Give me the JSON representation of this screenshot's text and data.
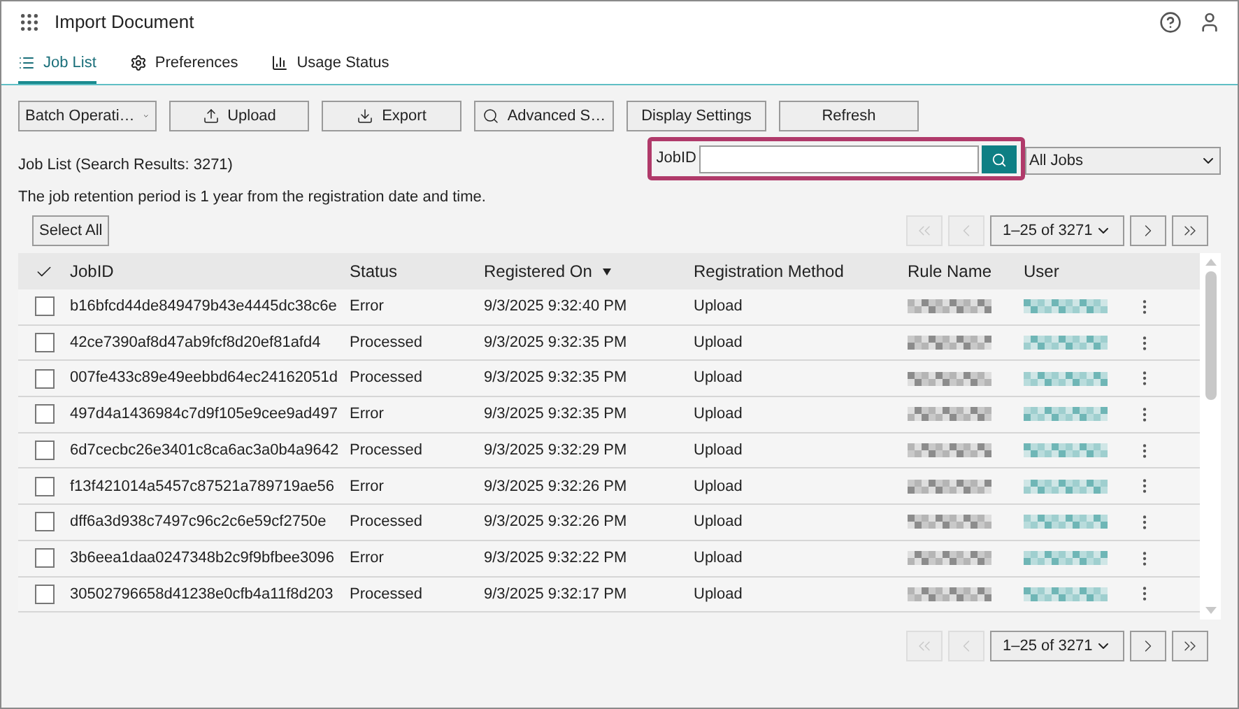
{
  "window": {
    "title": "Import Document"
  },
  "tabs": [
    {
      "label": "Job List",
      "selected": true
    },
    {
      "label": "Preferences",
      "selected": false
    },
    {
      "label": "Usage Status",
      "selected": false
    }
  ],
  "toolbar": [
    {
      "label": "Batch Operati…",
      "kind": "dropdown"
    },
    {
      "label": "Upload",
      "kind": "upload"
    },
    {
      "label": "Export",
      "kind": "export"
    },
    {
      "label": "Advanced S…",
      "kind": "search"
    },
    {
      "label": "Display Settings",
      "kind": "plain"
    },
    {
      "label": "Refresh",
      "kind": "plain"
    }
  ],
  "summary": "Job List (Search Results: 3271)",
  "notice": "The job retention period is 1 year from the registration date and time.",
  "search": {
    "label": "JobID"
  },
  "filter": {
    "value": "All Jobs"
  },
  "select_all": "Select All",
  "pagination_top": {
    "range": "1–25 of 3271",
    "first_disabled": true,
    "prev_disabled": true
  },
  "pagination_bottom": {
    "range": "1–25 of 3271",
    "first_disabled": true,
    "prev_disabled": true
  },
  "table": {
    "columns": [
      "JobID",
      "Status",
      "Registered On",
      "Registration Method",
      "Rule Name",
      "User"
    ],
    "rows": [
      {
        "checked": false,
        "cells": [
          "b16bfcd44de849479b43e4445dc38c6e",
          "Error",
          "9/3/2025 9:32:40 PM",
          "Upload"
        ]
      },
      {
        "checked": false,
        "cells": [
          "42ce7390af8d47ab9fcf8d20ef81afd4",
          "Processed",
          "9/3/2025 9:32:35 PM",
          "Upload"
        ]
      },
      {
        "checked": false,
        "cells": [
          "007fe433c89e49eebbd64ec24162051d",
          "Processed",
          "9/3/2025 9:32:35 PM",
          "Upload"
        ]
      },
      {
        "checked": false,
        "cells": [
          "497d4a1436984c7d9f105e9cee9ad497",
          "Error",
          "9/3/2025 9:32:35 PM",
          "Upload"
        ]
      },
      {
        "checked": false,
        "cells": [
          "6d7cecbc26e3401c8ca6ac3a0b4a9642",
          "Processed",
          "9/3/2025 9:32:29 PM",
          "Upload"
        ]
      },
      {
        "checked": false,
        "cells": [
          "f13f421014a5457c87521a789719ae56",
          "Error",
          "9/3/2025 9:32:26 PM",
          "Upload"
        ]
      },
      {
        "checked": false,
        "cells": [
          "dff6a3d938c7497c96c2c6e59cf2750e",
          "Processed",
          "9/3/2025 9:32:26 PM",
          "Upload"
        ]
      },
      {
        "checked": false,
        "cells": [
          "3b6eea1daa0247348b2c9f9bfbee3096",
          "Error",
          "9/3/2025 9:32:22 PM",
          "Upload"
        ]
      },
      {
        "checked": false,
        "cells": [
          "30502796658d41238e0cfb4a11f8d203",
          "Processed",
          "9/3/2025 9:32:17 PM",
          "Upload"
        ]
      }
    ]
  }
}
